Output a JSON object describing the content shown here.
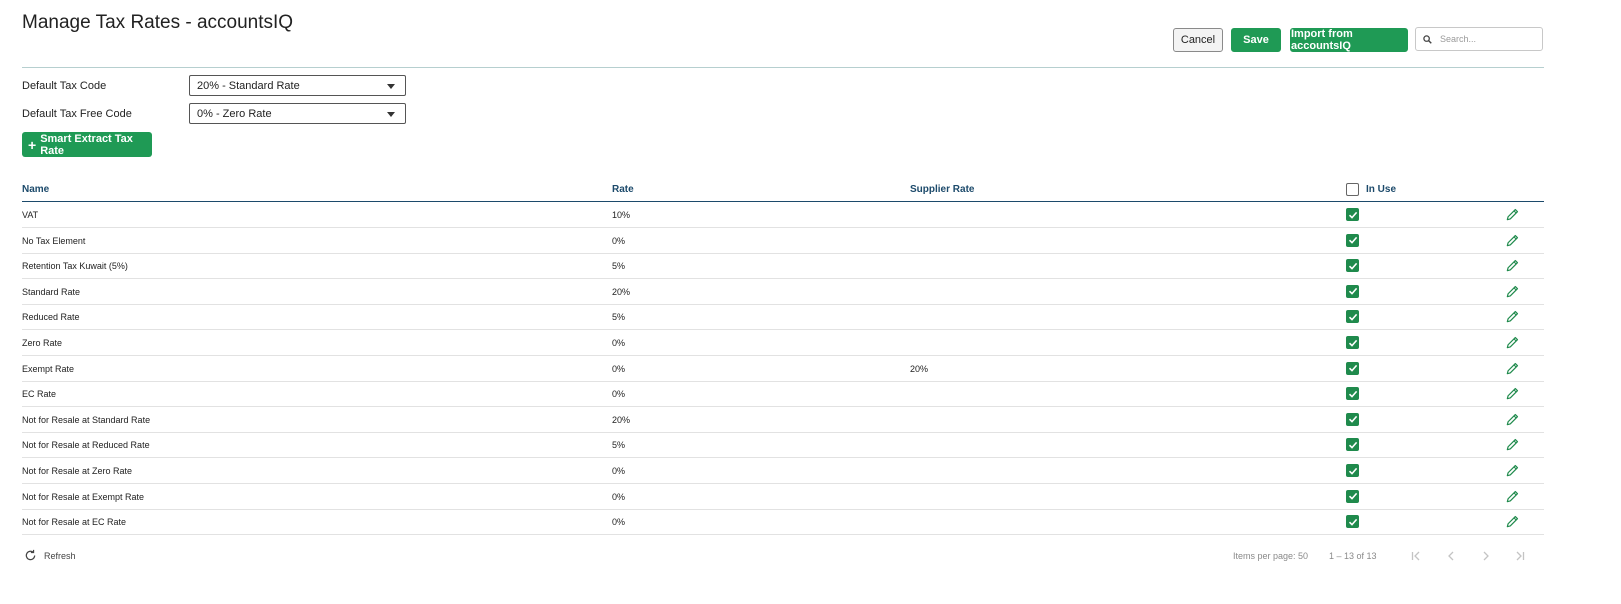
{
  "page": {
    "title": "Manage Tax Rates - accountsIQ"
  },
  "toolbar": {
    "cancel_label": "Cancel",
    "save_label": "Save",
    "import_label": "Import from accountsIQ",
    "search_placeholder": "Search..."
  },
  "settings": {
    "default_tax_code_label": "Default Tax Code",
    "default_tax_code_value": "20% - Standard Rate",
    "default_tax_free_code_label": "Default Tax Free Code",
    "default_tax_free_code_value": "0% - Zero Rate",
    "smart_extract_label": "Smart Extract Tax Rate"
  },
  "table": {
    "columns": {
      "name": "Name",
      "rate": "Rate",
      "supplier_rate": "Supplier Rate",
      "in_use": "In Use"
    },
    "rows": [
      {
        "name": "VAT",
        "rate": "10%",
        "supplier_rate": "",
        "in_use": true
      },
      {
        "name": "No Tax Element",
        "rate": "0%",
        "supplier_rate": "",
        "in_use": true
      },
      {
        "name": "Retention Tax Kuwait (5%)",
        "rate": "5%",
        "supplier_rate": "",
        "in_use": true
      },
      {
        "name": "Standard Rate",
        "rate": "20%",
        "supplier_rate": "",
        "in_use": true
      },
      {
        "name": "Reduced Rate",
        "rate": "5%",
        "supplier_rate": "",
        "in_use": true
      },
      {
        "name": "Zero Rate",
        "rate": "0%",
        "supplier_rate": "",
        "in_use": true
      },
      {
        "name": "Exempt Rate",
        "rate": "0%",
        "supplier_rate": "20%",
        "in_use": true
      },
      {
        "name": "EC Rate",
        "rate": "0%",
        "supplier_rate": "",
        "in_use": true
      },
      {
        "name": "Not for Resale at Standard Rate",
        "rate": "20%",
        "supplier_rate": "",
        "in_use": true
      },
      {
        "name": "Not for Resale at Reduced Rate",
        "rate": "5%",
        "supplier_rate": "",
        "in_use": true
      },
      {
        "name": "Not for Resale at Zero Rate",
        "rate": "0%",
        "supplier_rate": "",
        "in_use": true
      },
      {
        "name": "Not for Resale at Exempt Rate",
        "rate": "0%",
        "supplier_rate": "",
        "in_use": true
      },
      {
        "name": "Not for Resale at EC Rate",
        "rate": "0%",
        "supplier_rate": "",
        "in_use": true
      }
    ]
  },
  "footer": {
    "refresh_label": "Refresh",
    "items_per_page": "Items per page: 50",
    "range": "1 – 13 of 13"
  },
  "colors": {
    "accent": "#1f9a55",
    "header_text": "#1c4a6b"
  }
}
